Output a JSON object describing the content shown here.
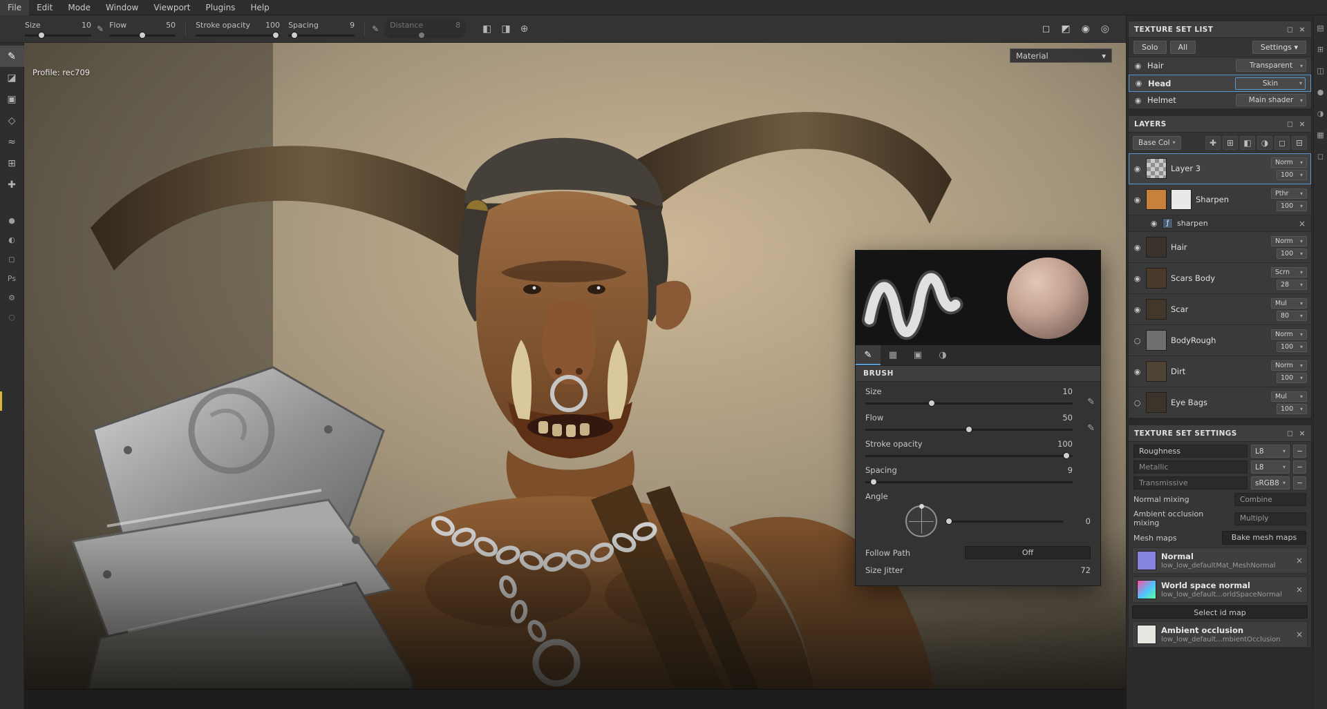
{
  "menubar": {
    "items": [
      "File",
      "Edit",
      "Mode",
      "Window",
      "Viewport",
      "Plugins",
      "Help"
    ]
  },
  "toolbar": {
    "size_label": "Size",
    "size_value": "10",
    "flow_label": "Flow",
    "flow_value": "50",
    "stroke_label": "Stroke opacity",
    "stroke_value": "100",
    "spacing_label": "Spacing",
    "spacing_value": "9",
    "distance_label": "Distance",
    "distance_value": "8"
  },
  "viewport": {
    "profile": "Profile: rec709",
    "material": "Material"
  },
  "brush": {
    "title": "BRUSH",
    "size_label": "Size",
    "size_value": "10",
    "flow_label": "Flow",
    "flow_value": "50",
    "stroke_label": "Stroke opacity",
    "stroke_value": "100",
    "spacing_label": "Spacing",
    "spacing_value": "9",
    "angle_label": "Angle",
    "angle_value": "0",
    "follow_path_label": "Follow Path",
    "follow_path_value": "Off",
    "size_jitter_label": "Size Jitter",
    "size_jitter_value": "72"
  },
  "texture_set_list": {
    "title": "TEXTURE SET LIST",
    "solo": "Solo",
    "all": "All",
    "settings": "Settings",
    "rows": [
      {
        "name": "Hair",
        "shader": "Transparent"
      },
      {
        "name": "Head",
        "shader": "Skin"
      },
      {
        "name": "Helmet",
        "shader": "Main shader"
      }
    ]
  },
  "layers": {
    "title": "LAYERS",
    "channel": "Base Col",
    "rows": [
      {
        "name": "Layer 3",
        "blend": "Norm",
        "opacity": "100",
        "vis": "◉",
        "thumb": ""
      },
      {
        "name": "Sharpen",
        "blend": "Pthr",
        "opacity": "100",
        "vis": "◉",
        "thumb": "#c8813a",
        "mask": "#e9e9e9",
        "effect": "sharpen"
      },
      {
        "name": "Hair",
        "blend": "Norm",
        "opacity": "100",
        "vis": "◉",
        "thumb": "#3a332c"
      },
      {
        "name": "Scars Body",
        "blend": "Scrn",
        "opacity": "28",
        "vis": "◉",
        "thumb": "#4a3a2c"
      },
      {
        "name": "Scar",
        "blend": "Mul",
        "opacity": "80",
        "vis": "◉",
        "thumb": "#42372a"
      },
      {
        "name": "BodyRough",
        "blend": "Norm",
        "opacity": "100",
        "vis": "○",
        "thumb": "#6f6f6f"
      },
      {
        "name": "Dirt",
        "blend": "Norm",
        "opacity": "100",
        "vis": "◉",
        "thumb": "#4e4335"
      },
      {
        "name": "Eye Bags",
        "blend": "Mul",
        "opacity": "100",
        "vis": "○",
        "thumb": "#3c332b"
      }
    ]
  },
  "texture_set_settings": {
    "title": "TEXTURE SET SETTINGS",
    "channels": [
      {
        "name": "Roughness",
        "format": "L8"
      },
      {
        "name": "Metallic",
        "format": "L8"
      },
      {
        "name": "Transmissive",
        "format": "sRGB8"
      }
    ],
    "normal_mixing_label": "Normal mixing",
    "normal_mixing_value": "Combine",
    "ao_mixing_label": "Ambient occlusion mixing",
    "ao_mixing_value": "Multiply",
    "mesh_maps_label": "Mesh maps",
    "bake_button": "Bake mesh maps",
    "maps": [
      {
        "name": "Normal",
        "file": "low_low_defaultMat_MeshNormal",
        "thumb": "#8784e0"
      },
      {
        "name": "World space normal",
        "file": "low_low_default...orldSpaceNormal",
        "thumb": "linear-gradient(135deg,#ff4fa0,#4fc3ff 55%,#5dff9a)"
      },
      {
        "name": "Ambient occlusion",
        "file": "low_low_default...mbientOcclusion",
        "thumb": "#e8e6e0"
      }
    ],
    "select_id_map": "Select id map"
  },
  "left_rail": {
    "tools": [
      {
        "name": "paint-tool",
        "glyph": "✎"
      },
      {
        "name": "eraser-tool",
        "glyph": "◪"
      },
      {
        "name": "projection-tool",
        "glyph": "▣"
      },
      {
        "name": "polygon-fill-tool",
        "glyph": "◇"
      },
      {
        "name": "smudge-tool",
        "glyph": "≈"
      },
      {
        "name": "clone-tool",
        "glyph": "⊞"
      },
      {
        "name": "material-picker-tool",
        "glyph": "✚"
      }
    ],
    "lower": [
      {
        "name": "sphere-view",
        "glyph": "●"
      },
      {
        "name": "shading-toggle",
        "glyph": "◐"
      },
      {
        "name": "display-panel",
        "glyph": "◻"
      },
      {
        "name": "ps-plugin",
        "glyph": "Ps"
      },
      {
        "name": "settings-plugin",
        "glyph": "⚙"
      },
      {
        "name": "misc-plugin",
        "glyph": "◌"
      }
    ]
  },
  "right_rail": {
    "icons": [
      {
        "name": "shelf-panel",
        "glyph": "▤"
      },
      {
        "name": "assets-panel",
        "glyph": "⊞"
      },
      {
        "name": "layers-panel",
        "glyph": "◫"
      },
      {
        "name": "material-panel",
        "glyph": "●"
      },
      {
        "name": "history-panel",
        "glyph": "◑"
      },
      {
        "name": "grid-panel",
        "glyph": "▦"
      },
      {
        "name": "properties-panel",
        "glyph": "◻"
      }
    ]
  },
  "layers_toolbar": [
    {
      "name": "add-effect",
      "glyph": "✚"
    },
    {
      "name": "add-stamp",
      "glyph": "⊞"
    },
    {
      "name": "add-fill-layer",
      "glyph": "◧"
    },
    {
      "name": "add-smart-material",
      "glyph": "◑"
    },
    {
      "name": "add-folder",
      "glyph": "◻"
    },
    {
      "name": "delete-layer",
      "glyph": "⊟"
    }
  ],
  "brush_tabs": [
    {
      "name": "brush-settings-tab",
      "glyph": "✎"
    },
    {
      "name": "alpha-tab",
      "glyph": "▦"
    },
    {
      "name": "stencil-tab",
      "glyph": "▣"
    },
    {
      "name": "material-tab",
      "glyph": "◑"
    }
  ],
  "toolbar_right_icons": [
    {
      "name": "viewport-settings",
      "glyph": "◻"
    },
    {
      "name": "material-mode",
      "glyph": "◩"
    },
    {
      "name": "camera-settings",
      "glyph": "◉"
    },
    {
      "name": "capture",
      "glyph": "◎"
    }
  ],
  "icons": {
    "stylus": "✎",
    "dropdown": "▾",
    "close": "×",
    "detach": "◻",
    "radio_on": "◉",
    "radio_off": "○",
    "minus": "−",
    "fx": "ƒ",
    "mirror_x": "◧",
    "mirror_y": "◨",
    "pivot": "⊕"
  },
  "colors": {
    "accent": "#5b9bd5"
  }
}
